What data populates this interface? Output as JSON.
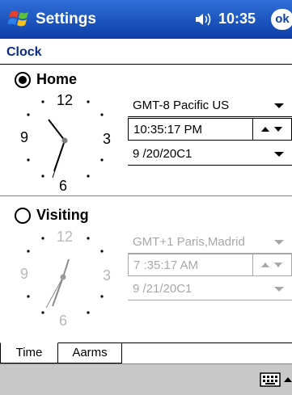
{
  "titlebar": {
    "app_title": "Settings",
    "time": "10:35",
    "ok_label": "ok",
    "icons": [
      "windows-start-icon",
      "speaker-icon"
    ]
  },
  "page": {
    "title": "Clock"
  },
  "home": {
    "label": "Home",
    "selected": true,
    "clock_numerals": {
      "twelve": "12",
      "three": "3",
      "six": "6",
      "nine": "9"
    },
    "timezone": "GMT-8 Pacific US",
    "time": "10:35:17 PM",
    "date": "9 /20/20C1"
  },
  "visiting": {
    "label": "Visiting",
    "selected": false,
    "clock_numerals": {
      "twelve": "12",
      "three": "3",
      "six": "6",
      "nine": "9"
    },
    "timezone": "GMT+1 Paris,Madrid",
    "time": "7 :35:17 AM",
    "date": "9 /21/20C1"
  },
  "tabs": [
    {
      "label": "Time",
      "active": true
    },
    {
      "label": "Aarms",
      "active": false
    }
  ],
  "colors": {
    "titlebar": "#1a4fc0",
    "header_text": "#0a2a8f",
    "disabled_text": "#a8a8a8",
    "command_bar": "#c8c8c8"
  },
  "command_bar": {
    "icons": [
      "keyboard-icon",
      "input-panel-arrow-icon"
    ]
  }
}
